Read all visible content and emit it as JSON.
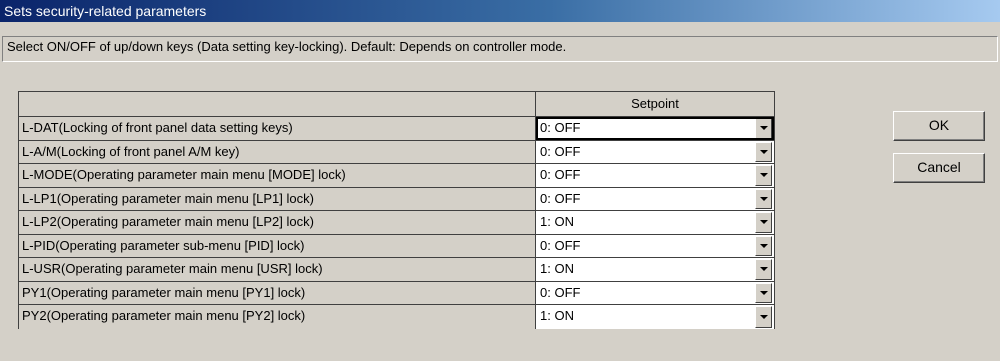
{
  "window": {
    "title": "Sets security-related parameters"
  },
  "description": "Select ON/OFF of up/down keys (Data setting key-locking).  Default: Depends on controller mode.",
  "grid": {
    "column_header": "Setpoint",
    "rows": [
      {
        "param": "L-DAT(Locking of front panel data setting keys)",
        "value": "0: OFF"
      },
      {
        "param": "L-A/M(Locking of front panel A/M key)",
        "value": "0: OFF"
      },
      {
        "param": "L-MODE(Operating parameter main menu [MODE] lock)",
        "value": "0: OFF"
      },
      {
        "param": "L-LP1(Operating parameter main menu [LP1] lock)",
        "value": "0: OFF"
      },
      {
        "param": "L-LP2(Operating parameter main menu [LP2] lock)",
        "value": "1: ON"
      },
      {
        "param": "L-PID(Operating parameter sub-menu [PID] lock)",
        "value": "0: OFF"
      },
      {
        "param": "L-USR(Operating parameter main menu [USR] lock)",
        "value": "1: ON"
      },
      {
        "param": "PY1(Operating parameter main menu [PY1] lock)",
        "value": "0: OFF"
      },
      {
        "param": "PY2(Operating parameter main menu [PY2] lock)",
        "value": "1: ON"
      }
    ]
  },
  "buttons": {
    "ok": "OK",
    "cancel": "Cancel"
  }
}
